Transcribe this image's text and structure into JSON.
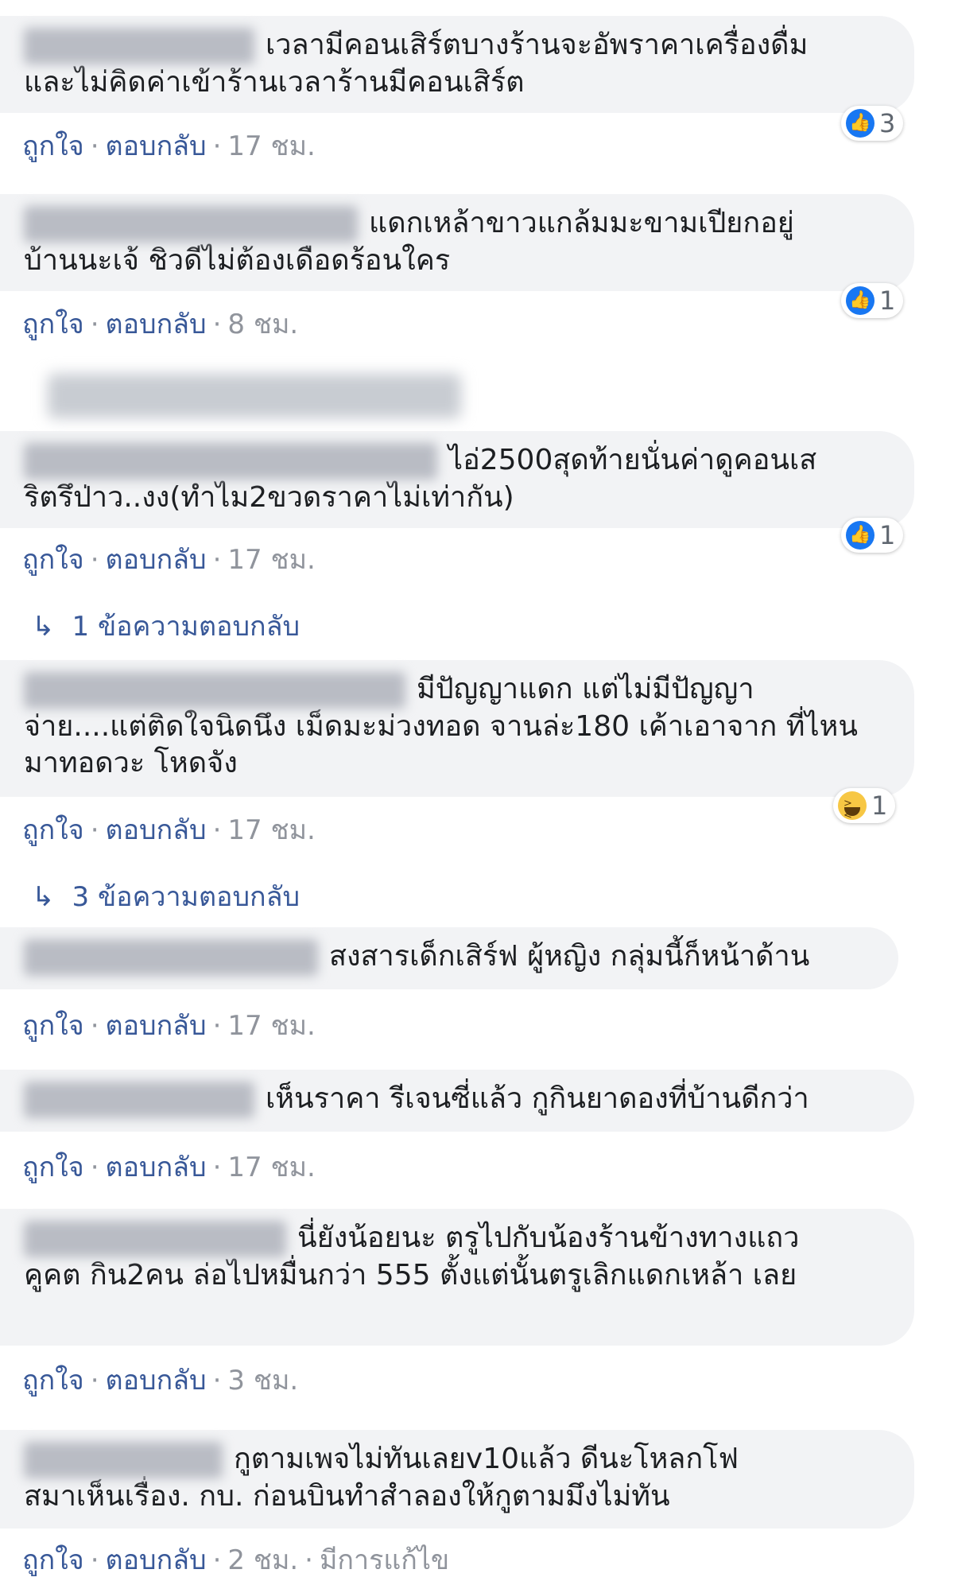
{
  "actions": {
    "like": "ถูกใจ",
    "reply": "ตอบกลับ",
    "sep": "·"
  },
  "comments": [
    {
      "text_line1": "เวลามีคอนเสิร์ตบางร้านจะอัพราคาเครื่องดื่ม",
      "text_rest": "และไม่คิดค่าเข้าร้านเวลาร้านมีคอนเสิร์ต",
      "reaction": "like",
      "reaction_count": "3",
      "time": "17 ชม."
    },
    {
      "text_line1": "แดกเหล้าขาวแกล้มมะขามเปียกอยู่",
      "text_rest": "บ้านนะเจ้ ชิวดีไม่ต้องเดือดร้อนใคร",
      "reaction": "like",
      "reaction_count": "1",
      "time": "8 ชม."
    },
    {
      "text_line1": "ไอ่2500สุดท้ายนั่นค่าดูคอนเส",
      "text_rest": "ริตรึป่าว..งง(ทำไม2ขวดราคาไม่เท่ากัน)",
      "reaction": "like",
      "reaction_count": "1",
      "time": "17 ชม.",
      "replies": "1 ข้อความตอบกลับ"
    },
    {
      "text_line1": "มีปัญญาแดก แต่ไม่มีปัญญา",
      "text_rest": "จ่าย....แต่ติดใจนิดนึง เม็ดมะม่วงทอด จานล่ะ180 เค้าเอาจาก ที่ไหนมาทอดวะ โหดจัง",
      "reaction": "haha",
      "reaction_count": "1",
      "time": "17 ชม.",
      "replies": "3 ข้อความตอบกลับ"
    },
    {
      "text_line1": "สงสารเด็กเสิร์ฟ ผู้หญิง กลุ่มนี้ก็หน้าด้าน",
      "text_rest": "",
      "time": "17 ชม."
    },
    {
      "text_line1": "เห็นราคา รีเจนซี่แล้ว กูกินยาดองที่บ้านดีกว่า",
      "text_rest": "",
      "time": "17 ชม."
    },
    {
      "text_line1": "นี่ยังน้อยนะ ตรูไปกับน้องร้านข้างทางแถว",
      "text_rest": "คูคต กิน2คน ล่อไปหมื่นกว่า 555 ตั้งแต่นั้นตรูเลิกแดกเหล้า เลย",
      "time": "3 ชม."
    },
    {
      "text_line1": "กูตามเพจไม่ทันเลยv10แล้ว ดีนะโหลกโฟ",
      "text_rest": "สมาเห็นเรื่อง. กบ. ก่อนบินทำสำลองให้กูตามมึงไม่ทัน",
      "time": "2 ชม.",
      "edited": "มีการแก้ไข"
    }
  ],
  "icons": {
    "like": "thumbs-up-icon",
    "haha": "haha-icon",
    "reply_arrow": "reply-arrow-icon"
  }
}
